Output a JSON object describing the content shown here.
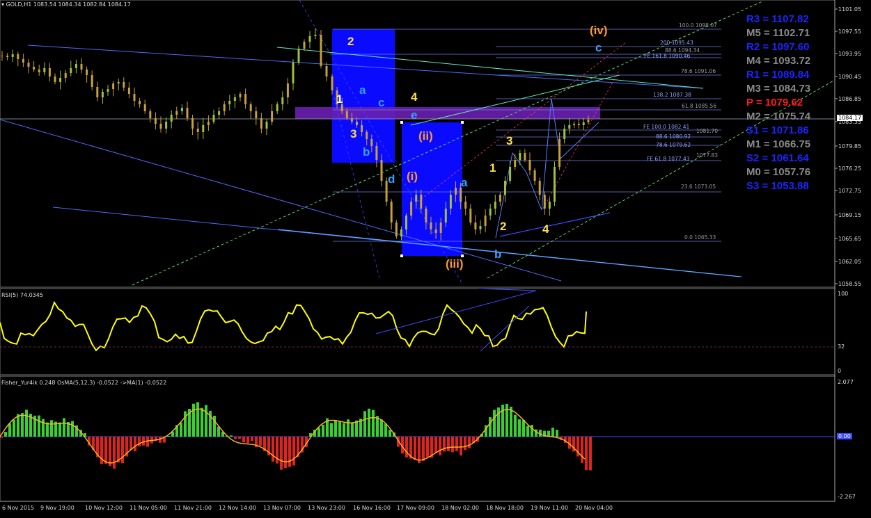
{
  "header": {
    "symbol": "GOLD,H1",
    "ohlc": "1083.54 1084.34 1082.84 1084.17",
    "rsi": "RSI(5) 74.0345",
    "fisher": "Fisher_Yur4ik 0.248  OsMA(5,12,3) -0.0522  ->MA(1) -0.0522"
  },
  "pivots": [
    {
      "label": "R3 = 1107.82",
      "color": "#1c24ff"
    },
    {
      "label": "M5 = 1102.71",
      "color": "#8a8a8a"
    },
    {
      "label": "R2 = 1097.60",
      "color": "#1c24ff"
    },
    {
      "label": "M4 = 1093.72",
      "color": "#8a8a8a"
    },
    {
      "label": "R1 = 1089.84",
      "color": "#1c24ff"
    },
    {
      "label": "M3 = 1084.73",
      "color": "#8a8a8a"
    },
    {
      "label": "P  = 1079.62",
      "color": "#ff1a1a"
    },
    {
      "label": "M2 = 1075.74",
      "color": "#8a8a8a"
    },
    {
      "label": "S1 = 1071.86",
      "color": "#1c24ff"
    },
    {
      "label": "M1 = 1066.75",
      "color": "#8a8a8a"
    },
    {
      "label": "S2 = 1061.64",
      "color": "#1c24ff"
    },
    {
      "label": "M0 = 1057.76",
      "color": "#8a8a8a"
    },
    {
      "label": "S3 = 1053.88",
      "color": "#1c24ff"
    }
  ],
  "price_axis": [
    "1101.05",
    "1097.55",
    "1093.95",
    "1090.45",
    "1086.85",
    "1083.35",
    "1079.85",
    "1076.25",
    "1072.75",
    "1069.15",
    "1065.65",
    "1062.05",
    "1058.55"
  ],
  "current_price": "1084.17",
  "rsi_axis": [
    "100",
    "32",
    "0"
  ],
  "fisher_axis": [
    "2.077",
    "0.00",
    "-2.267"
  ],
  "time_axis": [
    "6 Nov 2015",
    "9 Nov 19:00",
    "10 Nov 12:00",
    "11 Nov 05:00",
    "11 Nov 21:00",
    "12 Nov 14:00",
    "13 Nov 07:00",
    "13 Nov 23:00",
    "16 Nov 16:00",
    "17 Nov 09:00",
    "18 Nov 02:00",
    "18 Nov 18:00",
    "19 Nov 11:00",
    "20 Nov 04:00"
  ],
  "fib_labels": [
    {
      "text": "100.0  1098.07",
      "cls": "grey"
    },
    {
      "text": "200  1095.43",
      "cls": "fibl"
    },
    {
      "text": "88.6  1094.34",
      "cls": "grey"
    },
    {
      "text": "FE 161.8  1090.46",
      "cls": "fibl"
    },
    {
      "text": "78.6  1091.06",
      "cls": "grey"
    },
    {
      "text": "138.2  1087.38",
      "cls": "fibl"
    },
    {
      "text": "61.8  1085.56",
      "cls": "grey"
    },
    {
      "text": "FE 100.0  1082.41",
      "cls": "fibl"
    },
    {
      "text": "1081.70",
      "cls": "grey"
    },
    {
      "text": "88.6  1080.92",
      "cls": "fibl"
    },
    {
      "text": "78.6  1079.62",
      "cls": "fibl"
    },
    {
      "text": "FE 61.8  1077.43",
      "cls": "fibl"
    },
    {
      "text": "1077.83",
      "cls": "grey"
    },
    {
      "text": "23.6  1073.05",
      "cls": "grey"
    },
    {
      "text": "0.0  1065.33",
      "cls": "grey"
    }
  ],
  "waves": [
    {
      "text": "2",
      "color": "#ffe04a"
    },
    {
      "text": "1",
      "color": "#ffffff"
    },
    {
      "text": "a",
      "color": "#3aa0ff"
    },
    {
      "text": "4",
      "color": "#ffe04a"
    },
    {
      "text": "c",
      "color": "#3aa0ff"
    },
    {
      "text": "e",
      "color": "#3aa0ff"
    },
    {
      "text": "3",
      "color": "#ffe04a"
    },
    {
      "text": "b",
      "color": "#3aa0ff"
    },
    {
      "text": "(ii)",
      "color": "#ff9a2a"
    },
    {
      "text": "d",
      "color": "#3aa0ff"
    },
    {
      "text": "(i)",
      "color": "#ff9a2a"
    },
    {
      "text": "a",
      "color": "#3aa0ff"
    },
    {
      "text": "(iii)",
      "color": "#ff9a2a"
    },
    {
      "text": "3",
      "color": "#ffe04a"
    },
    {
      "text": "1",
      "color": "#ffe04a"
    },
    {
      "text": "2",
      "color": "#ffe04a"
    },
    {
      "text": "4",
      "color": "#ffe04a"
    },
    {
      "text": "b",
      "color": "#3aa0ff"
    },
    {
      "text": "(iv)",
      "color": "#ff9a2a"
    },
    {
      "text": "c",
      "color": "#3aa0ff"
    }
  ]
}
